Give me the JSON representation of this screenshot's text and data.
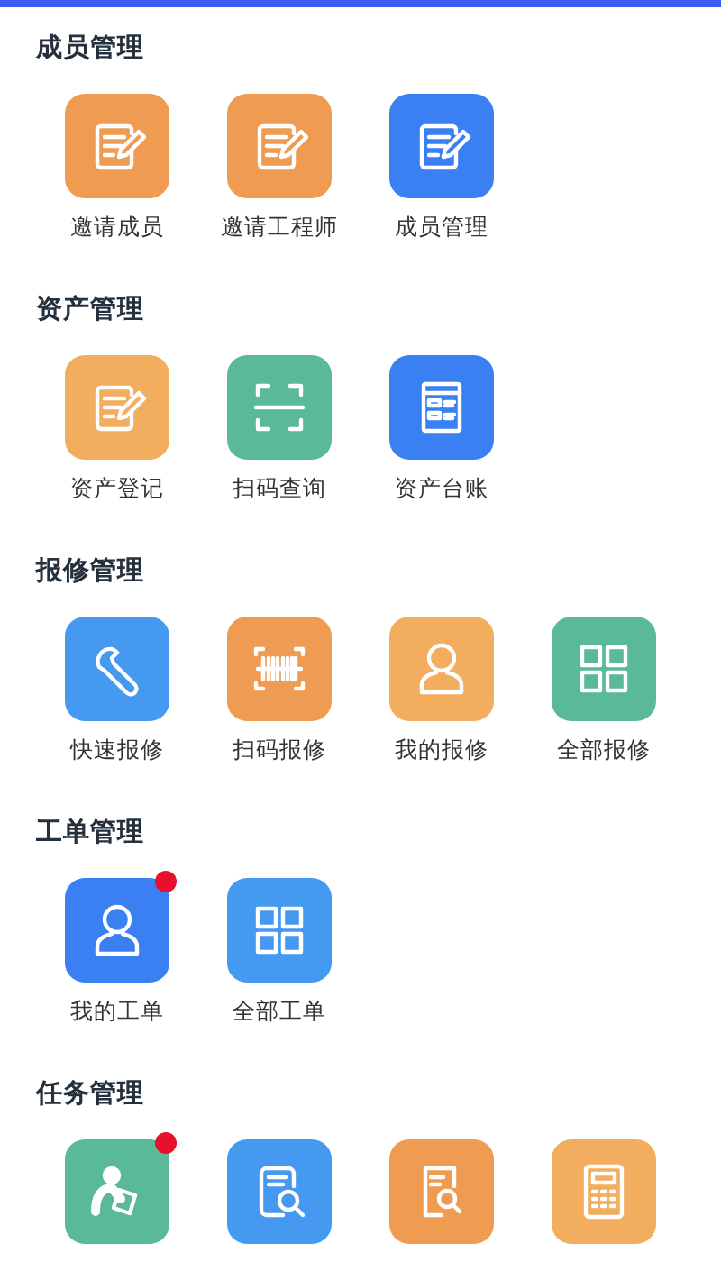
{
  "sections": [
    {
      "title": "成员管理",
      "items": [
        {
          "label": "邀请成员",
          "kind": "note",
          "color": "#f09b52",
          "badge": false
        },
        {
          "label": "邀请工程师",
          "kind": "note",
          "color": "#f09b52",
          "badge": false
        },
        {
          "label": "成员管理",
          "kind": "note",
          "color": "#3b80f2",
          "badge": false
        }
      ]
    },
    {
      "title": "资产管理",
      "items": [
        {
          "label": "资产登记",
          "kind": "note",
          "color": "#f2ad5e",
          "badge": false
        },
        {
          "label": "扫码查询",
          "kind": "scan",
          "color": "#5ab996",
          "badge": false
        },
        {
          "label": "资产台账",
          "kind": "ledger",
          "color": "#3b80f2",
          "badge": false
        }
      ]
    },
    {
      "title": "报修管理",
      "items": [
        {
          "label": "快速报修",
          "kind": "wrench",
          "color": "#4599f0",
          "badge": false
        },
        {
          "label": "扫码报修",
          "kind": "barcode",
          "color": "#f09b52",
          "badge": false
        },
        {
          "label": "我的报修",
          "kind": "person",
          "color": "#f2ad5e",
          "badge": false
        },
        {
          "label": "全部报修",
          "kind": "grid",
          "color": "#5ab996",
          "badge": false
        }
      ]
    },
    {
      "title": "工单管理",
      "items": [
        {
          "label": "我的工单",
          "kind": "person",
          "color": "#3b80f2",
          "badge": true
        },
        {
          "label": "全部工单",
          "kind": "grid",
          "color": "#4599f0",
          "badge": false
        }
      ]
    },
    {
      "title": "任务管理",
      "items": [
        {
          "kind": "reader",
          "color": "#5ab996",
          "badge": true
        },
        {
          "kind": "docsearch",
          "color": "#4599f0",
          "badge": false
        },
        {
          "kind": "filesearch",
          "color": "#f09b52",
          "badge": false
        },
        {
          "kind": "calculator",
          "color": "#f2ad5e",
          "badge": false
        }
      ]
    }
  ]
}
